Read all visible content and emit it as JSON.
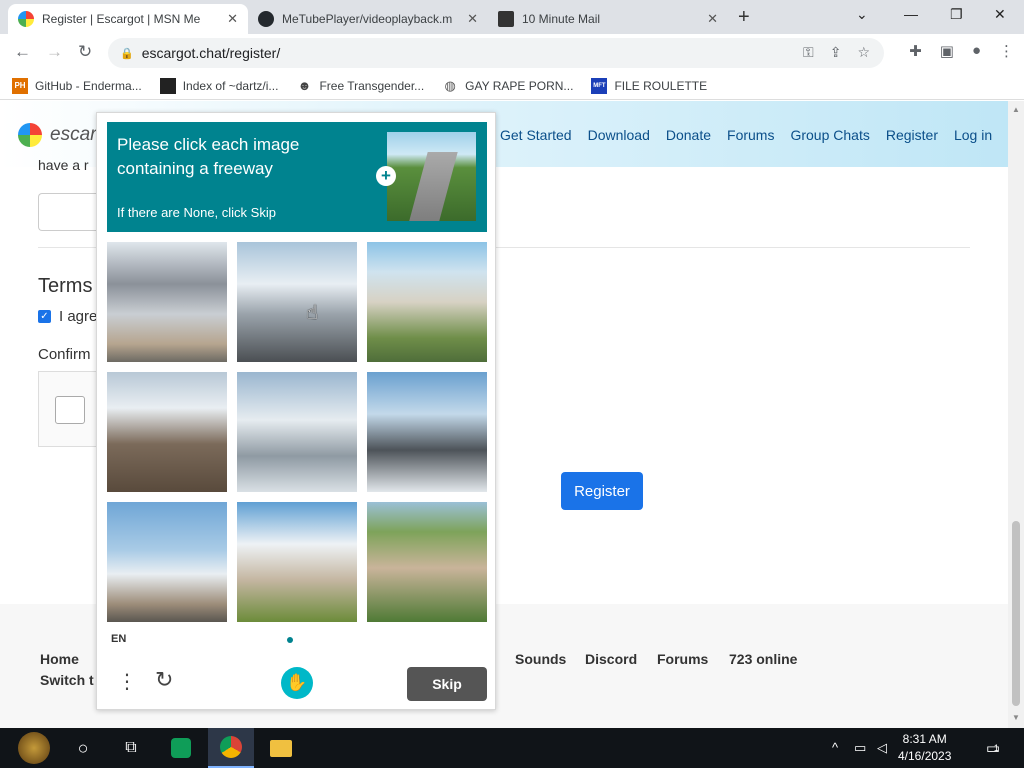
{
  "browser": {
    "tabs": [
      {
        "title": "Register | Escargot | MSN Me",
        "active": true,
        "icon": "escargot-logo-icon"
      },
      {
        "title": "MeTubePlayer/videoplayback.m",
        "active": false,
        "icon": "github-icon"
      },
      {
        "title": "10 Minute Mail",
        "active": false,
        "icon": "10-minute-mail-icon"
      }
    ],
    "url": "escargot.chat/register/",
    "bookmarks": [
      {
        "label": "GitHub - Enderma...",
        "icon": "ph-icon",
        "icon_text": "PH"
      },
      {
        "label": "Index of ~dartz/i...",
        "icon": "index-icon",
        "icon_text": ""
      },
      {
        "label": "Free Transgender...",
        "icon": "mask-icon",
        "icon_text": ""
      },
      {
        "label": "GAY RAPE PORN...",
        "icon": "globe-icon",
        "icon_text": ""
      },
      {
        "label": "FILE ROULETTE",
        "icon": "mft-icon",
        "icon_text": "MFT"
      }
    ]
  },
  "site": {
    "logo_text": "escargot",
    "nav": [
      "Get Started",
      "Download",
      "Donate",
      "Forums",
      "Group Chats",
      "Register",
      "Log in"
    ],
    "partial_text": "have a r",
    "terms_heading": "Terms",
    "agree_text": "I agre",
    "confirm_label": "Confirm",
    "register_button": "Register",
    "footer": {
      "col1": [
        "Home",
        "Switch t"
      ],
      "links": [
        "Sounds",
        "Discord",
        "Forums",
        "723 online"
      ]
    }
  },
  "hcaptcha": {
    "title": "Please click each image containing a freeway",
    "subtitle": "If there are None, click Skip",
    "language": "EN",
    "skip_label": "Skip",
    "tiles": [
      {
        "name": "tile-smokestack"
      },
      {
        "name": "tile-snowy-road"
      },
      {
        "name": "tile-town"
      },
      {
        "name": "tile-snowy-houses"
      },
      {
        "name": "tile-snowy-valley"
      },
      {
        "name": "tile-snowy-rail"
      },
      {
        "name": "tile-steam-plant"
      },
      {
        "name": "tile-cooling-tower"
      },
      {
        "name": "tile-aerial-city"
      }
    ]
  },
  "taskbar": {
    "time": "8:31 AM",
    "date": "4/16/2023",
    "notification_count": "1"
  },
  "colors": {
    "accent": "#1a73e8",
    "hcaptcha_teal": "#00838f",
    "taskbar": "#101418"
  }
}
